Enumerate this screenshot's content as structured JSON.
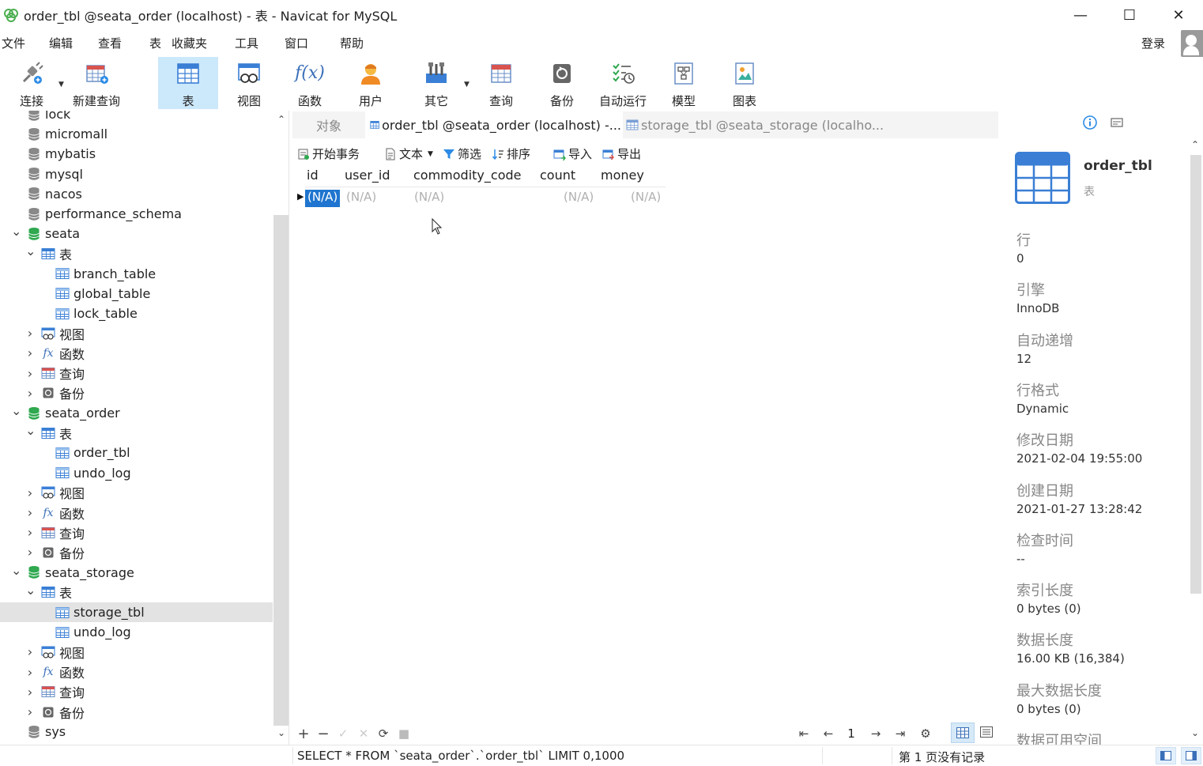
{
  "window": {
    "title": "order_tbl @seata_order (localhost) - 表 - Navicat for MySQL",
    "minimize": "—",
    "maximize": "☐",
    "close": "✕"
  },
  "menu": {
    "items": [
      "文件",
      "编辑",
      "查看",
      "表",
      "收藏夹",
      "工具",
      "窗口",
      "帮助"
    ],
    "login": "登录"
  },
  "toolbar": {
    "items": [
      {
        "label": "连接",
        "icon": "connect-icon"
      },
      {
        "label": "新建查询",
        "icon": "new-query-icon"
      },
      {
        "label": "表",
        "icon": "table-icon"
      },
      {
        "label": "视图",
        "icon": "view-icon"
      },
      {
        "label": "函数",
        "icon": "function-icon"
      },
      {
        "label": "用户",
        "icon": "user-icon"
      },
      {
        "label": "其它",
        "icon": "other-icon"
      },
      {
        "label": "查询",
        "icon": "query-icon"
      },
      {
        "label": "备份",
        "icon": "backup-icon"
      },
      {
        "label": "自动运行",
        "icon": "autorun-icon"
      },
      {
        "label": "模型",
        "icon": "model-icon"
      },
      {
        "label": "图表",
        "icon": "chart-icon"
      }
    ],
    "fx": "f(x)"
  },
  "tree": {
    "rows": [
      {
        "label": "lock",
        "type": "db",
        "level": 0,
        "chev": ""
      },
      {
        "label": "micromall",
        "type": "db",
        "level": 0,
        "chev": ""
      },
      {
        "label": "mybatis",
        "type": "db",
        "level": 0,
        "chev": ""
      },
      {
        "label": "mysql",
        "type": "db",
        "level": 0,
        "chev": ""
      },
      {
        "label": "nacos",
        "type": "db",
        "level": 0,
        "chev": ""
      },
      {
        "label": "performance_schema",
        "type": "db",
        "level": 0,
        "chev": ""
      },
      {
        "label": "seata",
        "type": "db-open",
        "level": 0,
        "chev": "v"
      },
      {
        "label": "表",
        "type": "tables",
        "level": 1,
        "chev": "v"
      },
      {
        "label": "branch_table",
        "type": "table",
        "level": 2,
        "chev": ""
      },
      {
        "label": "global_table",
        "type": "table",
        "level": 2,
        "chev": ""
      },
      {
        "label": "lock_table",
        "type": "table",
        "level": 2,
        "chev": ""
      },
      {
        "label": "视图",
        "type": "views",
        "level": 1,
        "chev": ">"
      },
      {
        "label": "函数",
        "type": "funcs",
        "level": 1,
        "chev": ">"
      },
      {
        "label": "查询",
        "type": "queries",
        "level": 1,
        "chev": ">"
      },
      {
        "label": "备份",
        "type": "backups",
        "level": 1,
        "chev": ">"
      },
      {
        "label": "seata_order",
        "type": "db-open",
        "level": 0,
        "chev": "v"
      },
      {
        "label": "表",
        "type": "tables",
        "level": 1,
        "chev": "v"
      },
      {
        "label": "order_tbl",
        "type": "table",
        "level": 2,
        "chev": ""
      },
      {
        "label": "undo_log",
        "type": "table",
        "level": 2,
        "chev": ""
      },
      {
        "label": "视图",
        "type": "views",
        "level": 1,
        "chev": ">"
      },
      {
        "label": "函数",
        "type": "funcs",
        "level": 1,
        "chev": ">"
      },
      {
        "label": "查询",
        "type": "queries",
        "level": 1,
        "chev": ">"
      },
      {
        "label": "备份",
        "type": "backups",
        "level": 1,
        "chev": ">"
      },
      {
        "label": "seata_storage",
        "type": "db-open",
        "level": 0,
        "chev": "v"
      },
      {
        "label": "表",
        "type": "tables",
        "level": 1,
        "chev": "v"
      },
      {
        "label": "storage_tbl",
        "type": "table",
        "level": 2,
        "chev": "",
        "selected": true
      },
      {
        "label": "undo_log",
        "type": "table",
        "level": 2,
        "chev": ""
      },
      {
        "label": "视图",
        "type": "views",
        "level": 1,
        "chev": ">"
      },
      {
        "label": "函数",
        "type": "funcs",
        "level": 1,
        "chev": ">"
      },
      {
        "label": "查询",
        "type": "queries",
        "level": 1,
        "chev": ">"
      },
      {
        "label": "备份",
        "type": "backups",
        "level": 1,
        "chev": ">"
      },
      {
        "label": "sys",
        "type": "db",
        "level": 0,
        "chev": ""
      }
    ]
  },
  "tabs": {
    "objects": "对象",
    "tab1": "order_tbl @seata_order (localhost) -...",
    "tab2": "storage_tbl @seata_storage (localho..."
  },
  "data_toolbar": {
    "begin_tx": "开始事务",
    "text": "文本",
    "filter": "筛选",
    "sort": "排序",
    "import": "导入",
    "export": "导出"
  },
  "grid": {
    "columns": [
      "id",
      "user_id",
      "commodity_code",
      "count",
      "money"
    ],
    "row": [
      "(N/A)",
      "(N/A)",
      "(N/A)",
      "(N/A)",
      "(N/A)"
    ]
  },
  "pager": {
    "page": "1"
  },
  "info": {
    "name": "order_tbl",
    "type": "表",
    "props": [
      {
        "label": "行",
        "value": "0"
      },
      {
        "label": "引擎",
        "value": "InnoDB"
      },
      {
        "label": "自动递增",
        "value": "12"
      },
      {
        "label": "行格式",
        "value": "Dynamic"
      },
      {
        "label": "修改日期",
        "value": "2021-02-04 19:55:00"
      },
      {
        "label": "创建日期",
        "value": "2021-01-27 13:28:42"
      },
      {
        "label": "检查时间",
        "value": "--"
      },
      {
        "label": "索引长度",
        "value": "0 bytes (0)"
      },
      {
        "label": "数据长度",
        "value": "16.00 KB (16,384)"
      },
      {
        "label": "最大数据长度",
        "value": "0 bytes (0)"
      },
      {
        "label": "数据可用空间",
        "value": ""
      }
    ]
  },
  "status": {
    "sql": "SELECT * FROM `seata_order`.`order_tbl` LIMIT 0,1000",
    "page": "第 1 页没有记录"
  },
  "colors": {
    "accent": "#1f75cf",
    "active_tool": "#cce8fb",
    "db_green": "#2fa84f"
  }
}
